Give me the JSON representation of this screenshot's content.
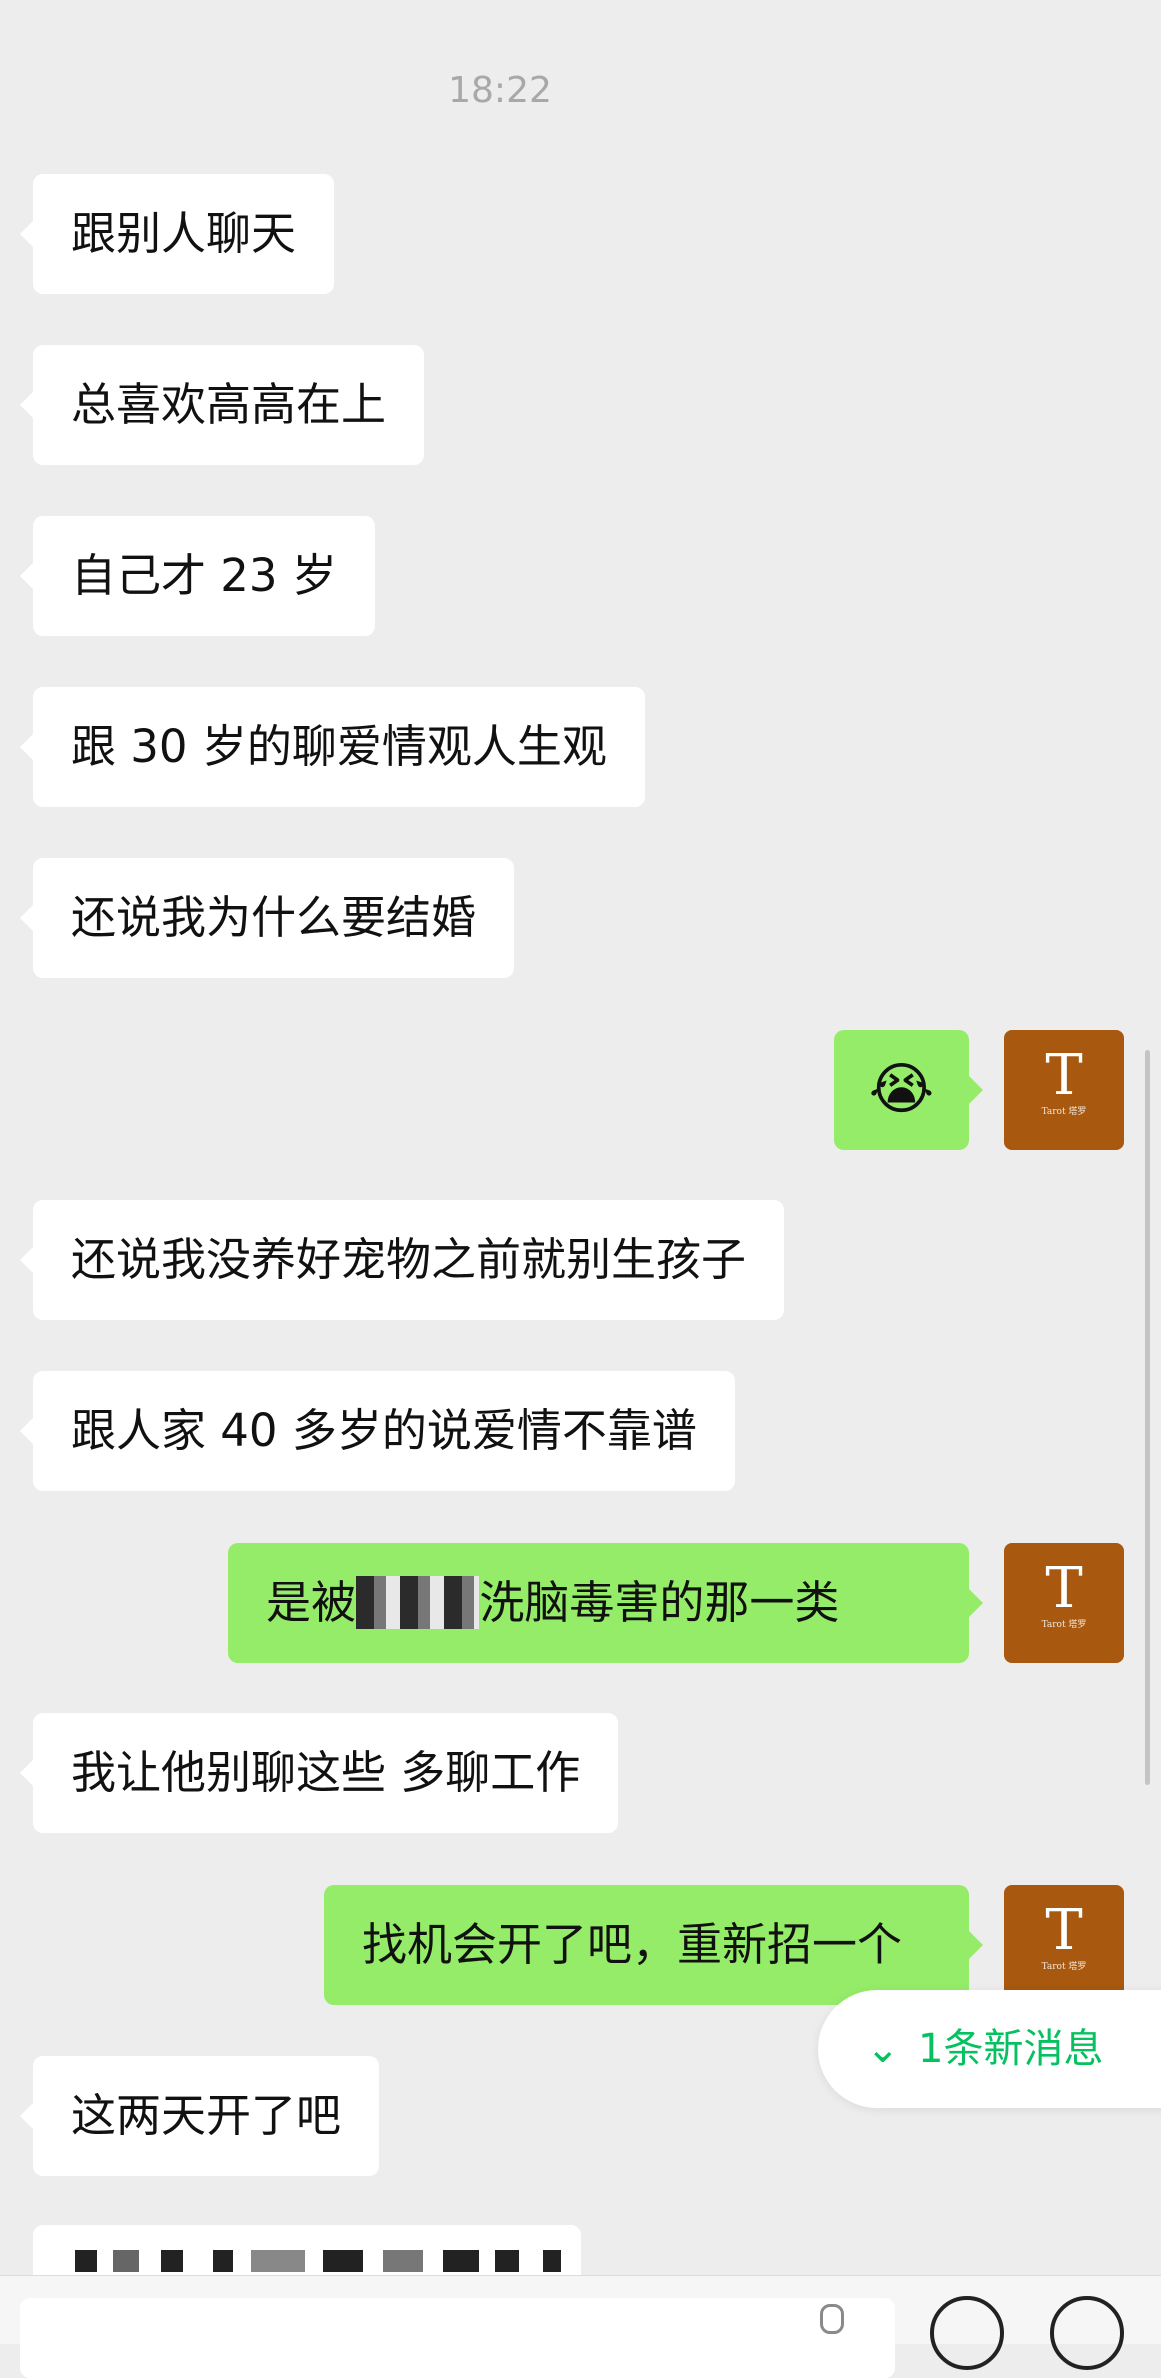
{
  "time": "18:22",
  "messages": [
    {
      "text": "跟别人聊天"
    },
    {
      "text": "总喜欢高高在上"
    },
    {
      "text": "自己才 23 岁"
    },
    {
      "text": "跟 30 岁的聊爱情观人生观"
    },
    {
      "text": "还说我为什么要结婚"
    },
    {
      "text": "😭"
    },
    {
      "text": "还说我没养好宠物之前就别生孩子"
    },
    {
      "text": "跟人家 40 多岁的说爱情不靠谱"
    },
    {
      "text": "是被",
      "text_after": "洗脑毒害的那一类"
    },
    {
      "text": "我让他别聊这些 多聊工作"
    },
    {
      "text": "找机会开了吧，重新招一个"
    },
    {
      "text": "这两天开了吧"
    }
  ],
  "avatar": {
    "letter": "T",
    "sub": "Tarot 塔罗"
  },
  "new_message_badge": "1条新消息",
  "colors": {
    "background": "#ededed",
    "outgoing": "#95ec69",
    "incoming": "#ffffff",
    "accent": "#07c160",
    "avatar": "#a8580f"
  }
}
